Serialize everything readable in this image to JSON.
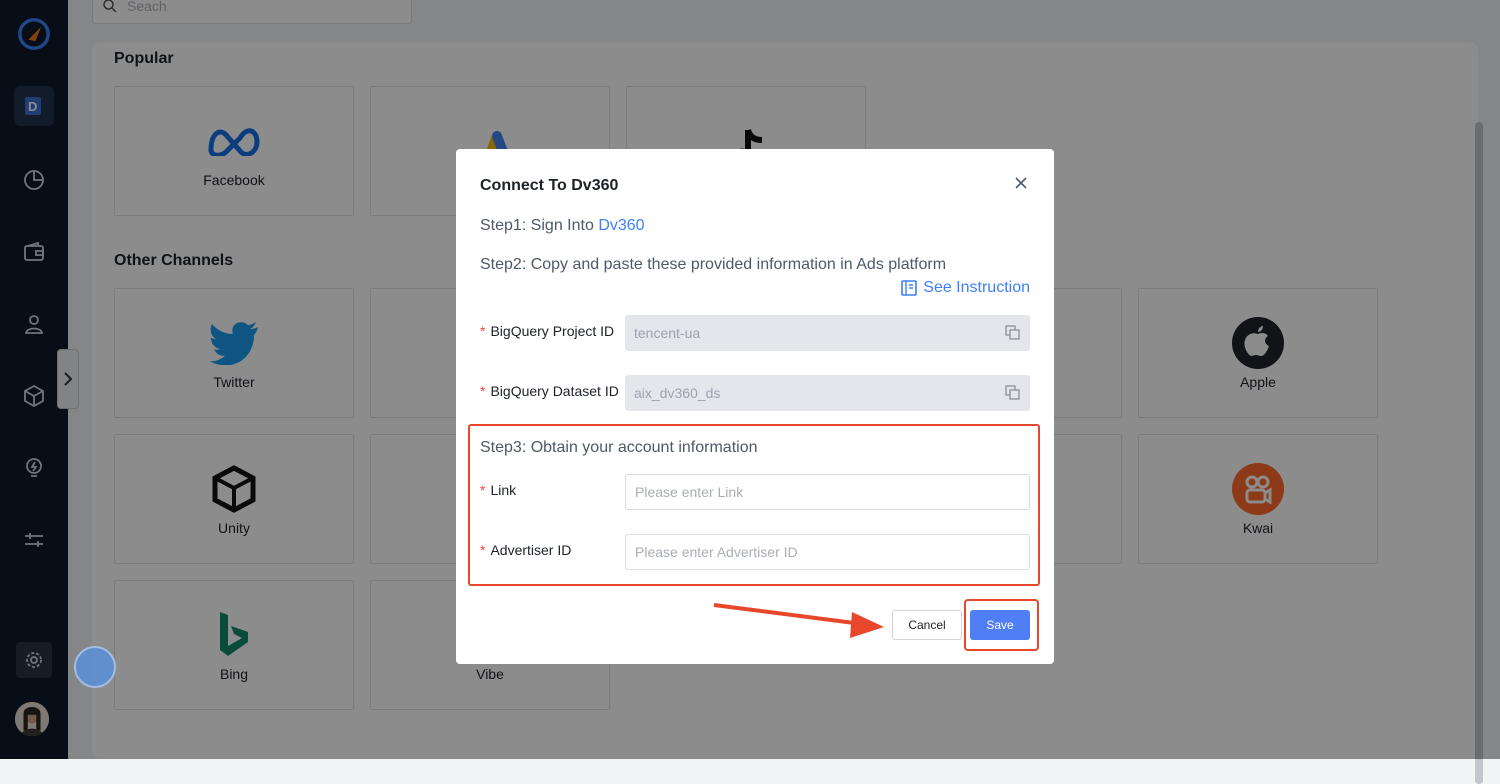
{
  "search": {
    "placeholder": "Seach"
  },
  "sections": {
    "popular": "Popular",
    "other": "Other Channels"
  },
  "popular_cards": [
    {
      "name": "Facebook",
      "icon": "meta-logo-icon"
    },
    {
      "name": "",
      "icon": "google-ads-logo-icon"
    },
    {
      "name": "",
      "icon": "tiktok-logo-icon"
    }
  ],
  "other_cards": [
    {
      "name": "Twitter",
      "icon": "twitter-logo-icon"
    },
    {
      "name": "Apple",
      "icon": "apple-logo-icon"
    },
    {
      "name": "Unity",
      "icon": "unity-logo-icon"
    },
    {
      "name": "Kwai",
      "icon": "kwai-logo-icon"
    },
    {
      "name": "Bing",
      "icon": "bing-logo-icon"
    },
    {
      "name": "Vibe",
      "icon": "vibe-logo-icon"
    }
  ],
  "sidebar": {
    "icons": [
      "app-logo-icon",
      "data-connect-icon",
      "pie-chart-icon",
      "wallet-icon",
      "user-icon",
      "package-icon",
      "lightbulb-icon",
      "sliders-icon",
      "settings-icon",
      "avatar"
    ]
  },
  "modal": {
    "title": "Connect To Dv360",
    "step1_prefix": "Step1: Sign Into ",
    "step1_link": "Dv360",
    "step2": "Step2: Copy and paste these provided information in Ads platform",
    "see_instruction": "See Instruction",
    "project_id_label": "BigQuery Project ID",
    "project_id_value": "tencent-ua",
    "dataset_id_label": "BigQuery Dataset ID",
    "dataset_id_value": "aix_dv360_ds",
    "step3": "Step3: Obtain your account information",
    "link_label": "Link",
    "link_placeholder": "Please enter Link",
    "advertiser_label": "Advertiser ID",
    "advertiser_placeholder": "Please enter Advertiser ID",
    "cancel": "Cancel",
    "save": "Save",
    "required_mark": "*"
  },
  "colors": {
    "accent": "#4f7ef5",
    "link": "#3d7ff5",
    "highlight": "#e8472b",
    "sidebar": "#0f1b2d"
  }
}
